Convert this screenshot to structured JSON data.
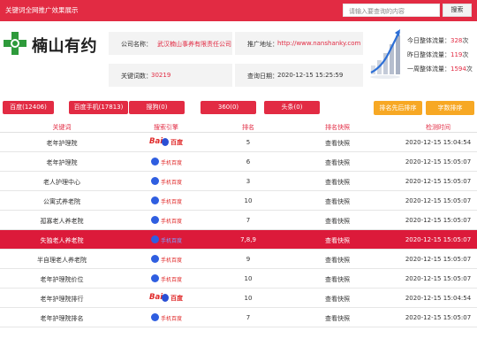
{
  "header": {
    "title": "关键词全网推广效果展示",
    "search_placeholder": "请输入要查询的内容",
    "search_button": "搜索"
  },
  "company": {
    "logo_text": "楠山有约",
    "name_label": "公司名称：",
    "name_value": "武汉楠山事养有限责任公司",
    "keyword_count_label": "关键词数：",
    "keyword_count_value": "30219",
    "site_label": "推广地址：",
    "site_value": "http://www.nanshanky.com",
    "query_date_label": "查询日期：",
    "query_date_value": "2020-12-15 15:25:59"
  },
  "traffic": {
    "today_label": "今日整体流量：",
    "today_value": "328",
    "yesterday_label": "昨日整体流量：",
    "yesterday_value": "119",
    "week_label": "一周整体流量：",
    "week_value": "1594",
    "unit": "次"
  },
  "tabs": [
    {
      "label": "百度(12406)"
    },
    {
      "label": "百度手机(17813)"
    },
    {
      "label": "搜狗(0)"
    },
    {
      "label": "360(0)"
    },
    {
      "label": "头条(0)"
    }
  ],
  "sort_buttons": {
    "rank_sort": "排名先后排序",
    "char_sort": "字数排序"
  },
  "table": {
    "columns": [
      "关键词",
      "搜索引擎",
      "排名",
      "排名快照",
      "检测时间"
    ],
    "rows": [
      {
        "keyword": "老年护理院",
        "engine": "baidu",
        "rank": "5",
        "snapshot": "查看快照",
        "time": "2020-12-15 15:04:54"
      },
      {
        "keyword": "老年护理院",
        "engine": "baidu-mobile",
        "rank": "6",
        "snapshot": "查看快照",
        "time": "2020-12-15 15:05:07"
      },
      {
        "keyword": "老人护理中心",
        "engine": "baidu-mobile",
        "rank": "3",
        "snapshot": "查看快照",
        "time": "2020-12-15 15:05:07"
      },
      {
        "keyword": "公寓式养老院",
        "engine": "baidu-mobile",
        "rank": "10",
        "snapshot": "查看快照",
        "time": "2020-12-15 15:05:07"
      },
      {
        "keyword": "孤寡老人养老院",
        "engine": "baidu-mobile",
        "rank": "7",
        "snapshot": "查看快照",
        "time": "2020-12-15 15:05:07"
      },
      {
        "keyword": "失独老人养老院",
        "engine": "baidu-mobile",
        "rank": "7,8,9",
        "snapshot": "查看快照",
        "time": "2020-12-15 15:05:07",
        "highlight": true
      },
      {
        "keyword": "半自理老人养老院",
        "engine": "baidu-mobile",
        "rank": "9",
        "snapshot": "查看快照",
        "time": "2020-12-15 15:05:07"
      },
      {
        "keyword": "老年护理院价位",
        "engine": "baidu-mobile",
        "rank": "10",
        "snapshot": "查看快照",
        "time": "2020-12-15 15:05:07"
      },
      {
        "keyword": "老年护理院排行",
        "engine": "baidu",
        "rank": "10",
        "snapshot": "查看快照",
        "time": "2020-12-15 15:04:54"
      },
      {
        "keyword": "老年护理院排名",
        "engine": "baidu-mobile",
        "rank": "7",
        "snapshot": "查看快照",
        "time": "2020-12-15 15:05:07"
      }
    ]
  },
  "engine_labels": {
    "baidu_bai": "Bai",
    "baidu_du": "百度",
    "mobile": "手机百度"
  },
  "colors": {
    "brand_red": "#e22b43",
    "highlight_row": "#dc1a3a",
    "sort_orange": "#f7a824"
  }
}
